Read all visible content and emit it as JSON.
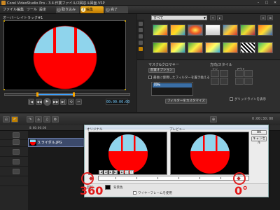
{
  "window": {
    "title": "Corel VideoStudio Pro - 3.4.作業ファイル/2図窓ル図面.VSP",
    "min_label": "–",
    "max_label": "□",
    "close_label": "✕"
  },
  "menu": [
    "ファイル",
    "編集",
    "ツール",
    "設定"
  ],
  "steps": [
    {
      "num": "1",
      "label": "取り込み"
    },
    {
      "num": "2",
      "label": "編集"
    },
    {
      "num": "3",
      "label": "完了"
    }
  ],
  "preview": {
    "label": "オーバーレイトラック#1",
    "timecode": "00:00:00:00",
    "controls": [
      "|◀",
      "◀◀",
      "▶",
      "▶▶",
      "▶|",
      "⟲",
      "✂"
    ]
  },
  "library": {
    "dropdown_value": "すべて",
    "tools": [
      "+",
      "▸",
      "≡",
      "⊞"
    ],
    "thumbs_row1": [
      "",
      "",
      "",
      "",
      "",
      "",
      ""
    ],
    "thumbs_row2": [
      "",
      "",
      "",
      "",
      "",
      "",
      ""
    ]
  },
  "options": {
    "mask_label": "マスク&クロマキー",
    "placement_label": "配置オプション",
    "apply_filter_label": "最後に使用したフィルターを置き換える",
    "filter_item": "回転",
    "customize_label": "フィルターをカスタマイズ",
    "direction_label": "方向/スタイル",
    "in_label": "イン",
    "out_label": "アウト",
    "pause_label": "一時停止",
    "grid_label": "グリッドラインを表示"
  },
  "timeline": {
    "time_start": "0:00:00:00",
    "time_end": "0:00:30:00",
    "clip_label": "3.ライダル.JPG",
    "tool_icons": [
      "⎌",
      "↶",
      "↷",
      "⌂",
      "♫",
      "⚙",
      "⊕"
    ]
  },
  "dialog": {
    "original_label": "オリジナル",
    "preview_label": "プレビュー",
    "ok_label": "OK",
    "cancel_label": "キャンセル",
    "tools": [
      "|◀",
      "◀",
      "▶",
      "▶|",
      "◆",
      "◇",
      "↔"
    ],
    "bottom_label": "回転",
    "swatch_label": "背景色",
    "checkbox_label": "ワイヤーフレームを使用"
  },
  "annotations": {
    "left_value": "360",
    "right_value": "0°"
  },
  "colors": {
    "accent": "#f0a000",
    "sky": "#8fd4ec",
    "red_fill": "#ff0000",
    "annotation": "#e21a1a"
  }
}
